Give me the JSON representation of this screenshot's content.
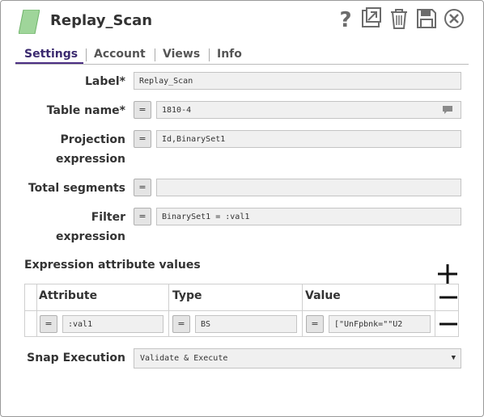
{
  "header": {
    "title": "Replay_Scan"
  },
  "colors": {
    "snap_icon": "#9fd59a",
    "active_tab": "#4b2e83",
    "toolbar_icon": "#6b6b6b"
  },
  "toolbar": {
    "icons": [
      "help-icon",
      "export-icon",
      "delete-icon",
      "save-icon",
      "close-icon"
    ]
  },
  "tabs": [
    {
      "label": "Settings",
      "active": true
    },
    {
      "label": "Account"
    },
    {
      "label": "Views"
    },
    {
      "label": "Info"
    }
  ],
  "fields": {
    "label": {
      "label": "Label*",
      "value": "Replay_Scan"
    },
    "table_name": {
      "label": "Table name*",
      "expr": "=",
      "value": "1810-4"
    },
    "projection": {
      "label_line1": "Projection",
      "label_line2": "expression",
      "expr": "=",
      "value": "Id,BinarySet1"
    },
    "total_segments": {
      "label": "Total segments",
      "expr": "=",
      "value": ""
    },
    "filter": {
      "label_line1": "Filter",
      "label_line2": "expression",
      "expr": "=",
      "value": "BinarySet1 = :val1"
    }
  },
  "expr_attr": {
    "title": "Expression attribute values",
    "columns": [
      "Attribute",
      "Type",
      "Value"
    ],
    "rows": [
      {
        "attribute_expr": "=",
        "attribute": ":val1",
        "type_expr": "=",
        "type": "BS",
        "value_expr": "=",
        "value": "[\"UnFpbnk=\"\"U2"
      }
    ]
  },
  "snap_execution": {
    "label": "Snap Execution",
    "value": "Validate & Execute"
  }
}
